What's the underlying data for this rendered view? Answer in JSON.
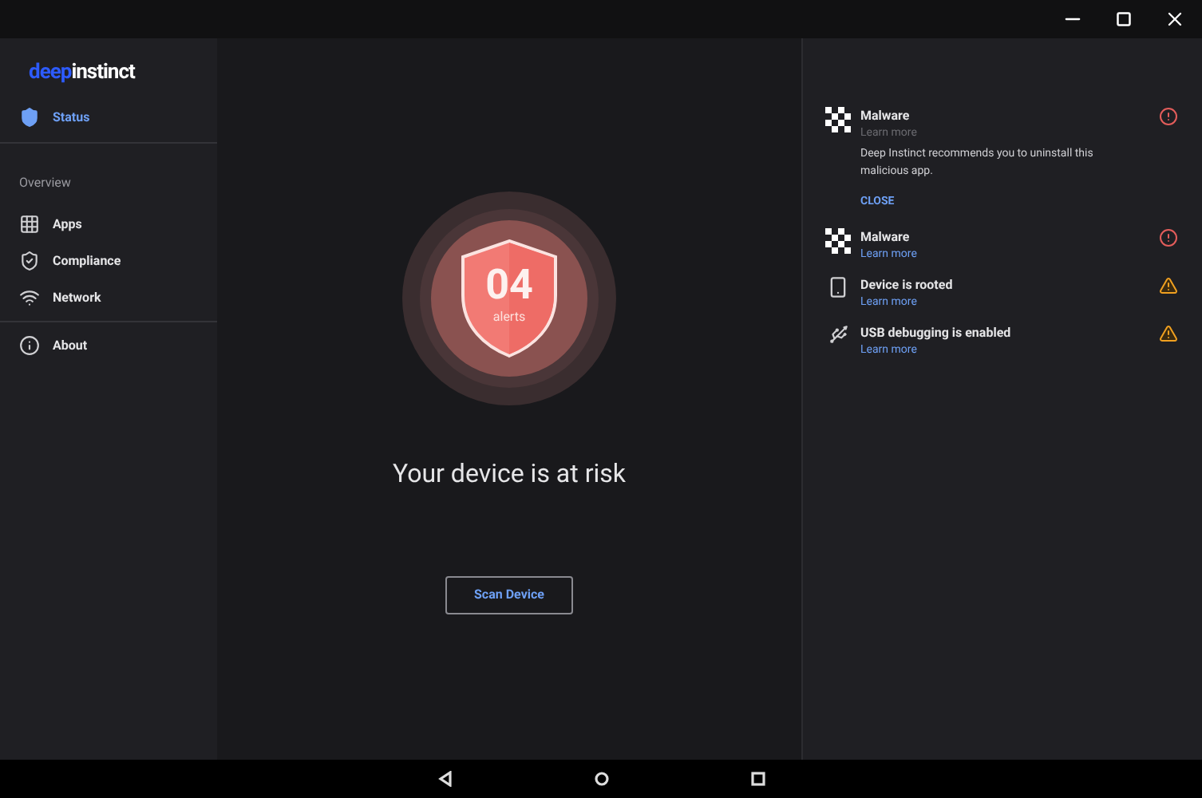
{
  "logo": {
    "part_1": "deep",
    "part_2": "instinct"
  },
  "sidebar": {
    "items": [
      {
        "label": "Status",
        "selected": true,
        "kind": "item"
      },
      {
        "label": "Overview",
        "kind": "header"
      },
      {
        "label": "Apps",
        "selected": false,
        "kind": "item"
      },
      {
        "label": "Compliance",
        "selected": false,
        "kind": "item"
      },
      {
        "label": "Network",
        "selected": false,
        "kind": "item"
      },
      {
        "label": "About",
        "selected": false,
        "kind": "item"
      }
    ]
  },
  "status": {
    "count": "04",
    "count_label": "alerts",
    "message": "Your device is at risk",
    "button": "Scan Device"
  },
  "alerts": [
    {
      "title": "Malware",
      "link": "Learn more",
      "kind": "error",
      "expanded": true,
      "description": "Deep Instinct recommends you to uninstall this malicious app.",
      "close": "CLOSE"
    },
    {
      "title": "Malware",
      "link": "Learn more",
      "kind": "error",
      "expanded": false
    },
    {
      "title": "Device is rooted",
      "link": "Learn more",
      "kind": "warning",
      "expanded": false
    },
    {
      "title": "USB debugging is enabled",
      "link": "Learn more",
      "kind": "warning",
      "expanded": false
    }
  ]
}
